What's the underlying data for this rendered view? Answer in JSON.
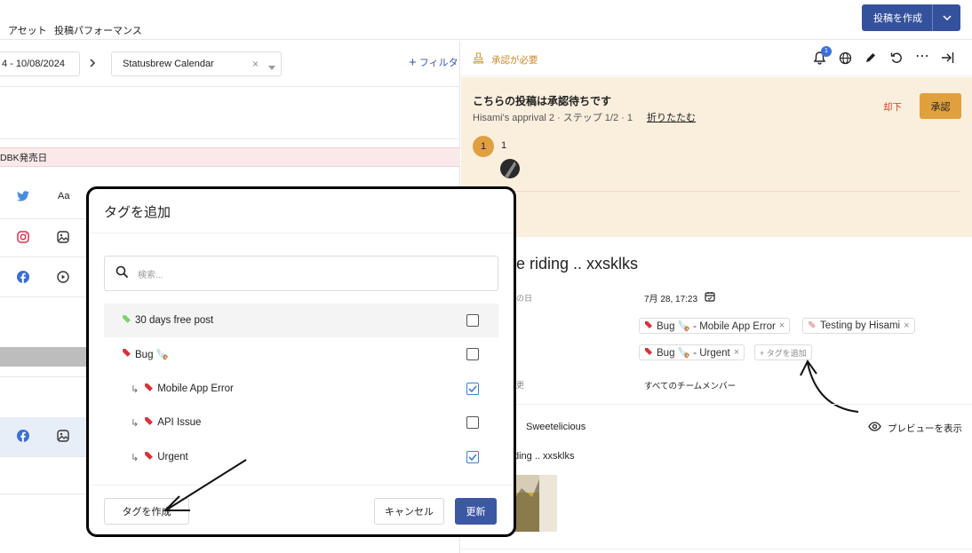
{
  "topnav": {
    "assets": "アセット",
    "performance": "投稿パフォーマンス",
    "create_post": "投稿を作成"
  },
  "left": {
    "date_range": "4 - 10/08/2024",
    "calendar": "Statusbrew Calendar",
    "filter": "フィルタ",
    "pink_row": "DBK発売日",
    "aa": "Aa"
  },
  "right": {
    "approval_needed": "承認が必要",
    "notif_count": "1",
    "pending_title": "こちらの投稿は承認待ちです",
    "pending_sub": "Hisami's apprival 2 · ステップ 1/2 · 1",
    "collapse": "折りたたむ",
    "reject": "却下",
    "approve": "承認",
    "step_num": "1",
    "step_count": "1",
    "post_title": "e riding .. xxsklks",
    "field_date_label": "の日",
    "date_value": "7月 28, 17:23",
    "tags": [
      "Bug 🪚 - Mobile App Error",
      "Testing by Hisami",
      "Bug 🪚 - Urgent"
    ],
    "add_tag": "+ タグを追加",
    "field_vis_label": "更",
    "visibility": "すべてのチームメンバー",
    "account": "Sweetelicious",
    "preview": "プレビューを表示",
    "snippet": "ding .. xxsklks"
  },
  "modal": {
    "title": "タグを追加",
    "search_placeholder": "検索...",
    "items": [
      {
        "label": "30 days free post",
        "checked": false,
        "indent": false,
        "color": "#7bd36b"
      },
      {
        "label": "Bug 🪚",
        "checked": false,
        "indent": false,
        "color": "#d6323a"
      },
      {
        "label": "Mobile App Error",
        "checked": true,
        "indent": true,
        "color": "#d6323a"
      },
      {
        "label": "API Issue",
        "checked": false,
        "indent": true,
        "color": "#d6323a"
      },
      {
        "label": "Urgent",
        "checked": true,
        "indent": true,
        "color": "#d6323a"
      }
    ],
    "create_tag": "タグを作成",
    "cancel": "キャンセル",
    "update": "更新"
  },
  "colors": {
    "brand": "#34529c",
    "approve": "#e0a03e",
    "approval_bg": "#faeedd",
    "check": "#3e7fd1"
  }
}
